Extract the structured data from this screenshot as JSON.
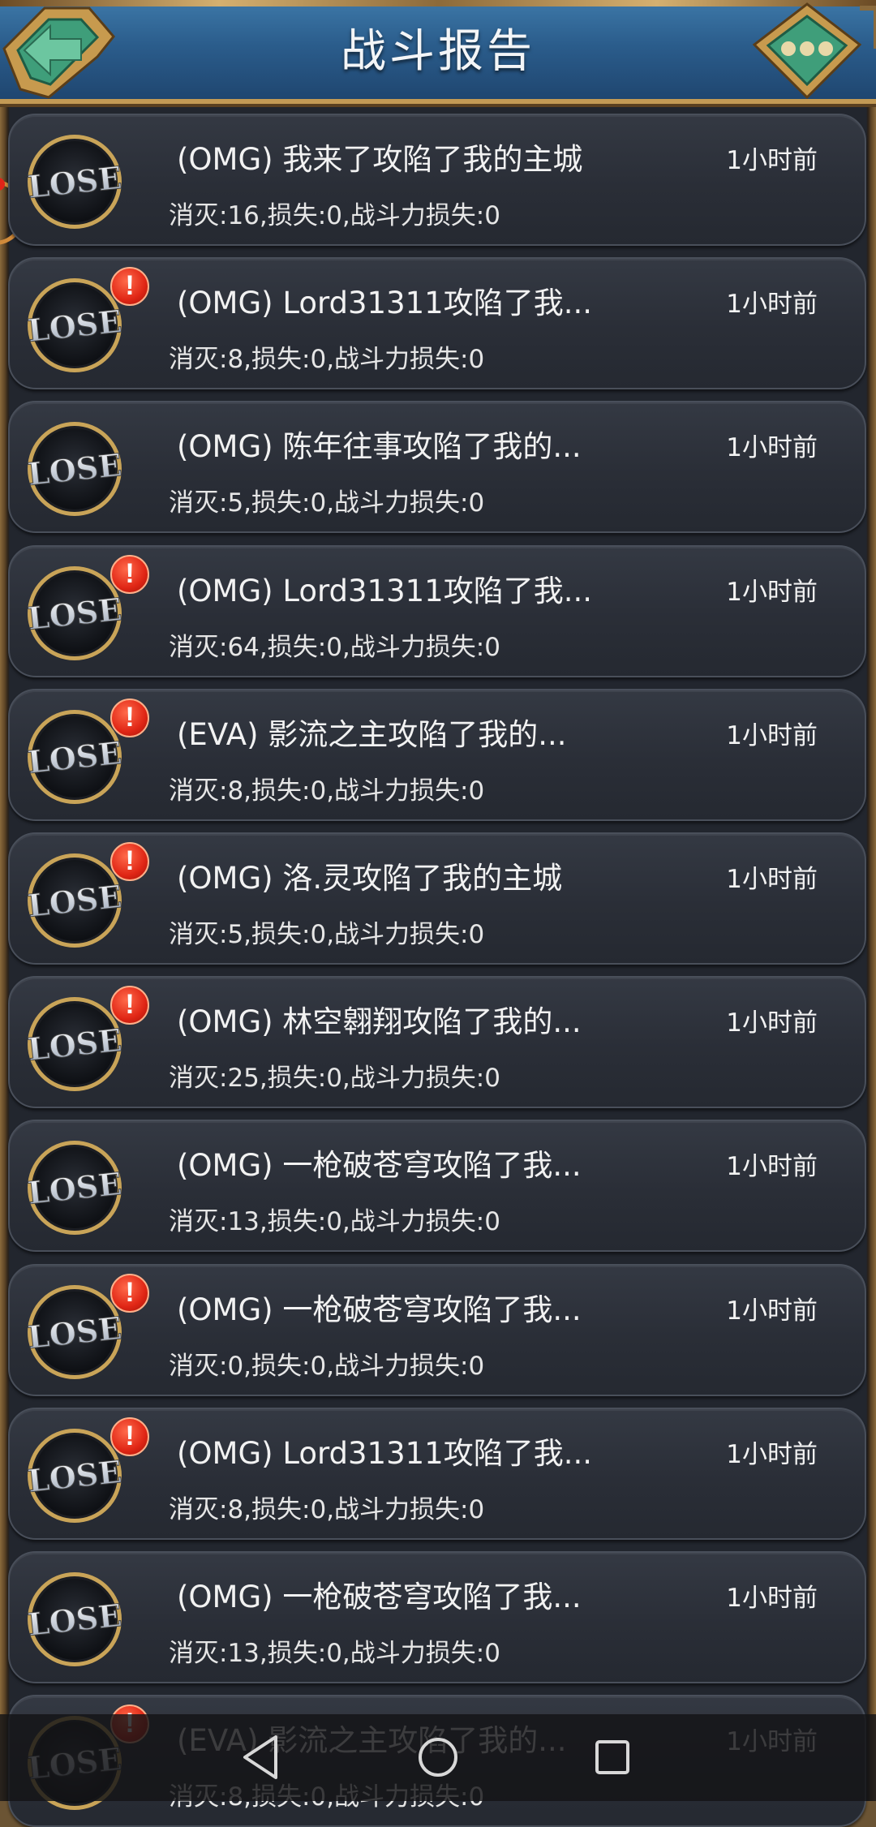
{
  "header": {
    "title": "战斗报告"
  },
  "badge_text": "LOSE",
  "colors": {
    "alert": "#e02615",
    "header": "#2b5d8c",
    "card": "#2a2e37"
  },
  "reports": [
    {
      "title": "(OMG) 我来了攻陷了我的主城",
      "time": "1小时前",
      "stats": "消灭:16,损失:0,战斗力损失:0",
      "alert": false
    },
    {
      "title": "(OMG) Lord31311攻陷了我...",
      "time": "1小时前",
      "stats": "消灭:8,损失:0,战斗力损失:0",
      "alert": true
    },
    {
      "title": "(OMG) 陈年往事攻陷了我的...",
      "time": "1小时前",
      "stats": "消灭:5,损失:0,战斗力损失:0",
      "alert": false
    },
    {
      "title": "(OMG) Lord31311攻陷了我...",
      "time": "1小时前",
      "stats": "消灭:64,损失:0,战斗力损失:0",
      "alert": true
    },
    {
      "title": "(EVA) 影流之主攻陷了我的...",
      "time": "1小时前",
      "stats": "消灭:8,损失:0,战斗力损失:0",
      "alert": true
    },
    {
      "title": "(OMG) 洛.灵攻陷了我的主城",
      "time": "1小时前",
      "stats": "消灭:5,损失:0,战斗力损失:0",
      "alert": true
    },
    {
      "title": "(OMG) 林空翱翔攻陷了我的...",
      "time": "1小时前",
      "stats": "消灭:25,损失:0,战斗力损失:0",
      "alert": true
    },
    {
      "title": "(OMG) 一枪破苍穹攻陷了我...",
      "time": "1小时前",
      "stats": "消灭:13,损失:0,战斗力损失:0",
      "alert": false
    },
    {
      "title": "(OMG) 一枪破苍穹攻陷了我...",
      "time": "1小时前",
      "stats": "消灭:0,损失:0,战斗力损失:0",
      "alert": true
    },
    {
      "title": "(OMG) Lord31311攻陷了我...",
      "time": "1小时前",
      "stats": "消灭:8,损失:0,战斗力损失:0",
      "alert": true
    },
    {
      "title": "(OMG) 一枪破苍穹攻陷了我...",
      "time": "1小时前",
      "stats": "消灭:13,损失:0,战斗力损失:0",
      "alert": false
    },
    {
      "title": "(EVA) 影流之主攻陷了我的...",
      "time": "1小时前",
      "stats": "消灭:8,损失:0,战斗力损失:0",
      "alert": true
    }
  ],
  "navbar": {
    "icons": [
      "back-triangle-icon",
      "home-circle-icon",
      "recents-square-icon"
    ]
  }
}
